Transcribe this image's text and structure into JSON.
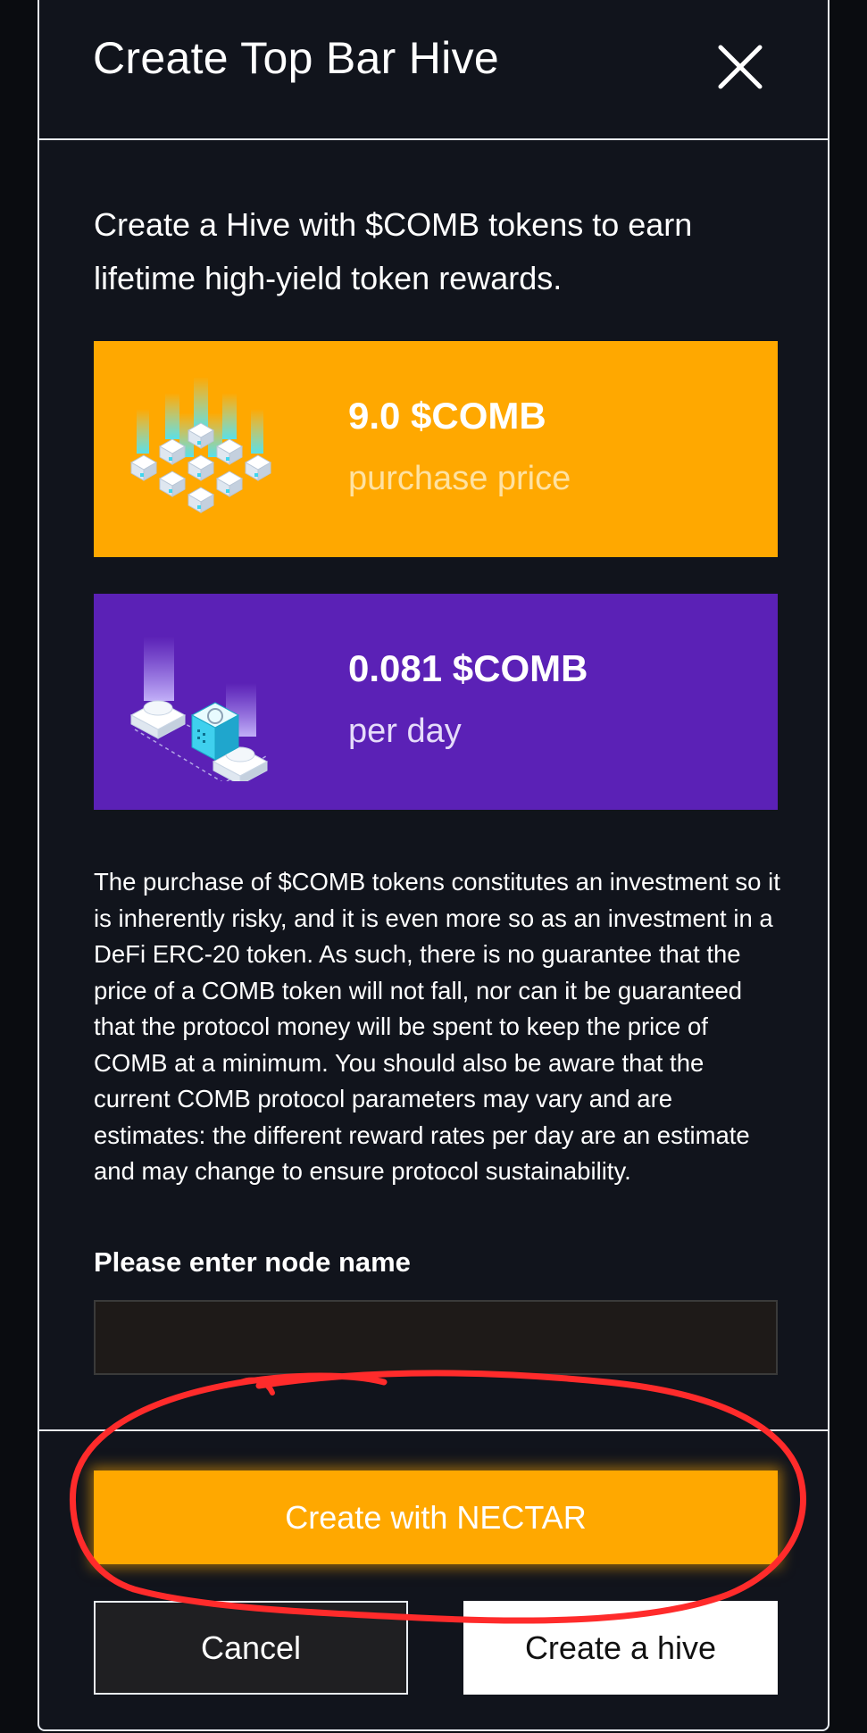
{
  "modal": {
    "title": "Create Top Bar Hive",
    "intro": "Create a Hive with $COMB tokens to earn lifetime high-yield token rewards."
  },
  "cards": {
    "price": {
      "value": "9.0 $COMB",
      "label": "purchase price",
      "icon": "hive-blocks-icon",
      "color": "#ffa800"
    },
    "daily": {
      "value": "0.081 $COMB",
      "label": "per day",
      "icon": "node-network-icon",
      "color": "#5b21b6"
    }
  },
  "disclaimer": "The purchase of $COMB tokens constitutes an investment so it is inherently risky, and it is even more so as an investment in a DeFi ERC-20 token. As such, there is no guarantee that the price of a COMB token will not fall, nor can it be guaranteed that the protocol money will be spent to keep the price of COMB at a minimum. You should also be aware that the current COMB protocol parameters may vary and are estimates: the different reward rates per day are an estimate and may change to ensure protocol sustainability.",
  "form": {
    "node_name_label": "Please enter node name",
    "node_name_value": ""
  },
  "actions": {
    "nectar_label": "Create with NECTAR",
    "cancel_label": "Cancel",
    "create_label": "Create a hive"
  },
  "colors": {
    "accent_orange": "#ffa800",
    "accent_purple": "#5b21b6",
    "background": "#11141c",
    "annotation_red": "#ff2b2b"
  }
}
